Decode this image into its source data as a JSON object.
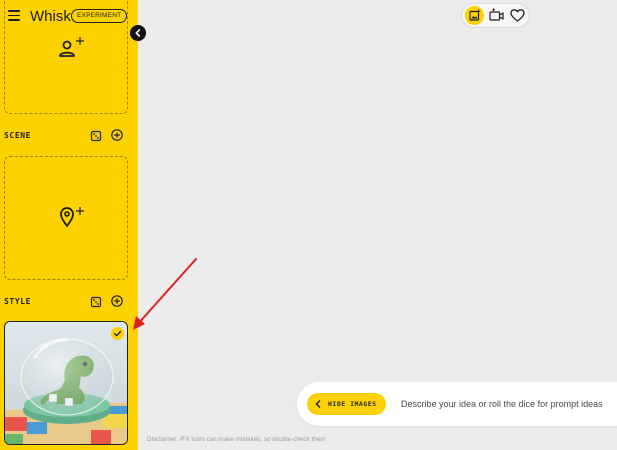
{
  "app": {
    "title": "Whisk",
    "badge": "EXPERIMENT"
  },
  "sidebar": {
    "sections": [
      {
        "id": "subject",
        "icon": "person-add-icon"
      },
      {
        "id": "scene",
        "label": "SCENE",
        "icon": "location-pin-add-icon"
      },
      {
        "id": "style",
        "label": "STYLE",
        "selected": true
      }
    ],
    "style_card_image": "glass-dome-green-dinosaur-toy"
  },
  "toolbar": {
    "modes": [
      "image-mode-icon",
      "video-mode-icon",
      "favorites-heart-icon"
    ],
    "active_mode": "image"
  },
  "prompt": {
    "hide_images_label": "HIDE IMAGES",
    "placeholder": "Describe your idea or roll the dice for prompt ideas"
  },
  "disclaimer": "Disclaimer: /FX tools can make mistakes, so double-check them",
  "colors": {
    "accent": "#fdd200",
    "background": "#ececec",
    "annotation_arrow": "#e02020"
  }
}
